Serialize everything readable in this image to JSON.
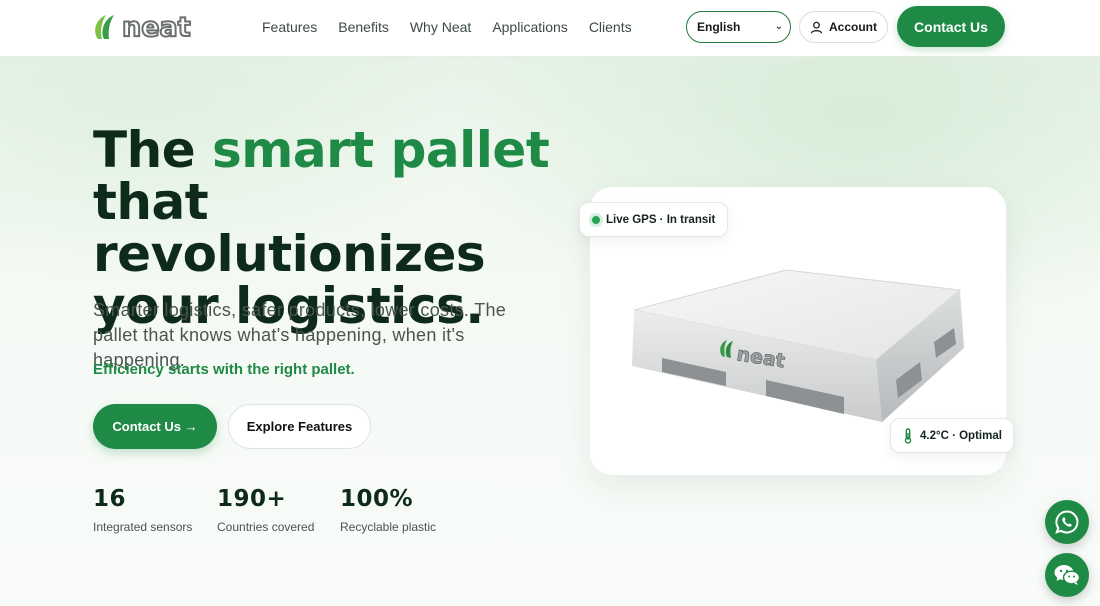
{
  "brand": {
    "logo_text": "neat"
  },
  "nav": {
    "items": [
      "Features",
      "Benefits",
      "Why Neat",
      "Applications",
      "Clients"
    ]
  },
  "header": {
    "language": {
      "selected": "English"
    },
    "account_label": "Account",
    "contact_label": "Contact Us"
  },
  "hero": {
    "title_part1": "The ",
    "title_accent": "smart pallet",
    "title_part2": " that revolutionizes your logistics.",
    "subtitle": "Smarter logistics, safer products, lower costs. The pallet that knows what's happening, when it's happening.",
    "tagline": "Efficiency starts with the right pallet.",
    "primary_cta": "Contact Us →",
    "secondary_cta": "Explore Features"
  },
  "stats": [
    {
      "value": "16",
      "label": "Integrated sensors"
    },
    {
      "value": "190+",
      "label": "Countries covered"
    },
    {
      "value": "100%",
      "label": "Recyclable plastic"
    }
  ],
  "product_card": {
    "gps_chip": "Live GPS · In transit",
    "temp_chip": "4.2°C · Optimal",
    "pallet_logo_text": "neat"
  },
  "floating": {
    "whatsapp_icon": "whatsapp-icon",
    "wechat_icon": "wechat-icon"
  },
  "colors": {
    "brand_green": "#1f8a45",
    "dark_text": "#0e2a1b",
    "status_dot": "#22a455"
  }
}
